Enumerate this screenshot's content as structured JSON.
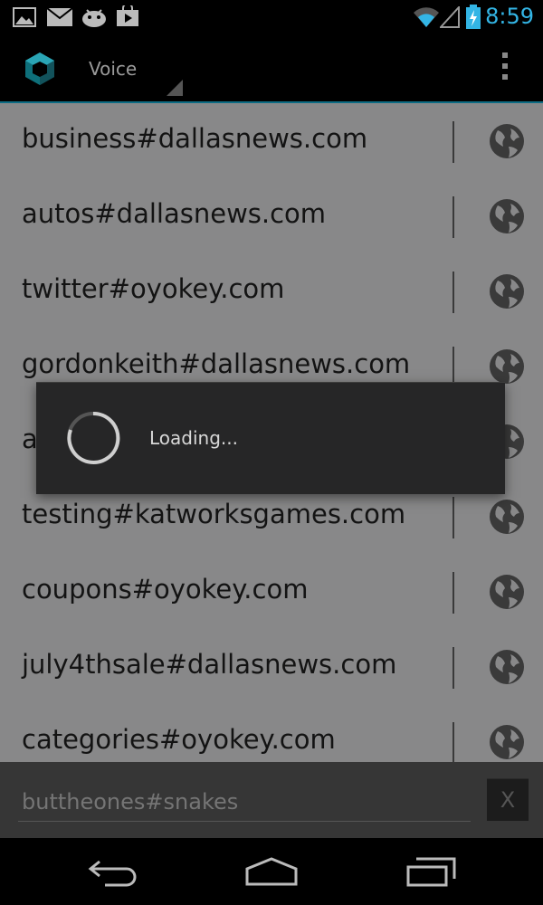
{
  "status_bar": {
    "time": "8:59",
    "icons": [
      "gallery-icon",
      "gmail-icon",
      "android-icon",
      "play-store-icon",
      "wifi-icon",
      "signal-icon",
      "battery-charging-icon"
    ]
  },
  "action_bar": {
    "title": "Voice",
    "logo_icon": "cube-logo-icon",
    "overflow_icon": "overflow-menu-icon"
  },
  "list": {
    "items": [
      {
        "label": "business#dallasnews.com",
        "icon": "globe-icon"
      },
      {
        "label": "autos#dallasnews.com",
        "icon": "globe-icon"
      },
      {
        "label": "twitter#oyokey.com",
        "icon": "globe-icon"
      },
      {
        "label": "gordonkeith#dallasnews.com",
        "icon": "globe-icon"
      },
      {
        "label": "a",
        "icon": "globe-icon"
      },
      {
        "label": "testing#katworksgames.com",
        "icon": "globe-icon"
      },
      {
        "label": "coupons#oyokey.com",
        "icon": "globe-icon"
      },
      {
        "label": "july4thsale#dallasnews.com",
        "icon": "globe-icon"
      },
      {
        "label": "categories#oyokey.com",
        "icon": "globe-icon"
      }
    ]
  },
  "input": {
    "placeholder": "buttheones#snakes",
    "clear_label": "X"
  },
  "dialog": {
    "message": "Loading..."
  },
  "nav_bar": {
    "icons": [
      "back-icon",
      "home-icon",
      "recent-apps-icon"
    ]
  },
  "colors": {
    "accent": "#33b5e5",
    "list_background": "#888889",
    "dialog_background": "#262627",
    "dark_bar": "#363636"
  }
}
